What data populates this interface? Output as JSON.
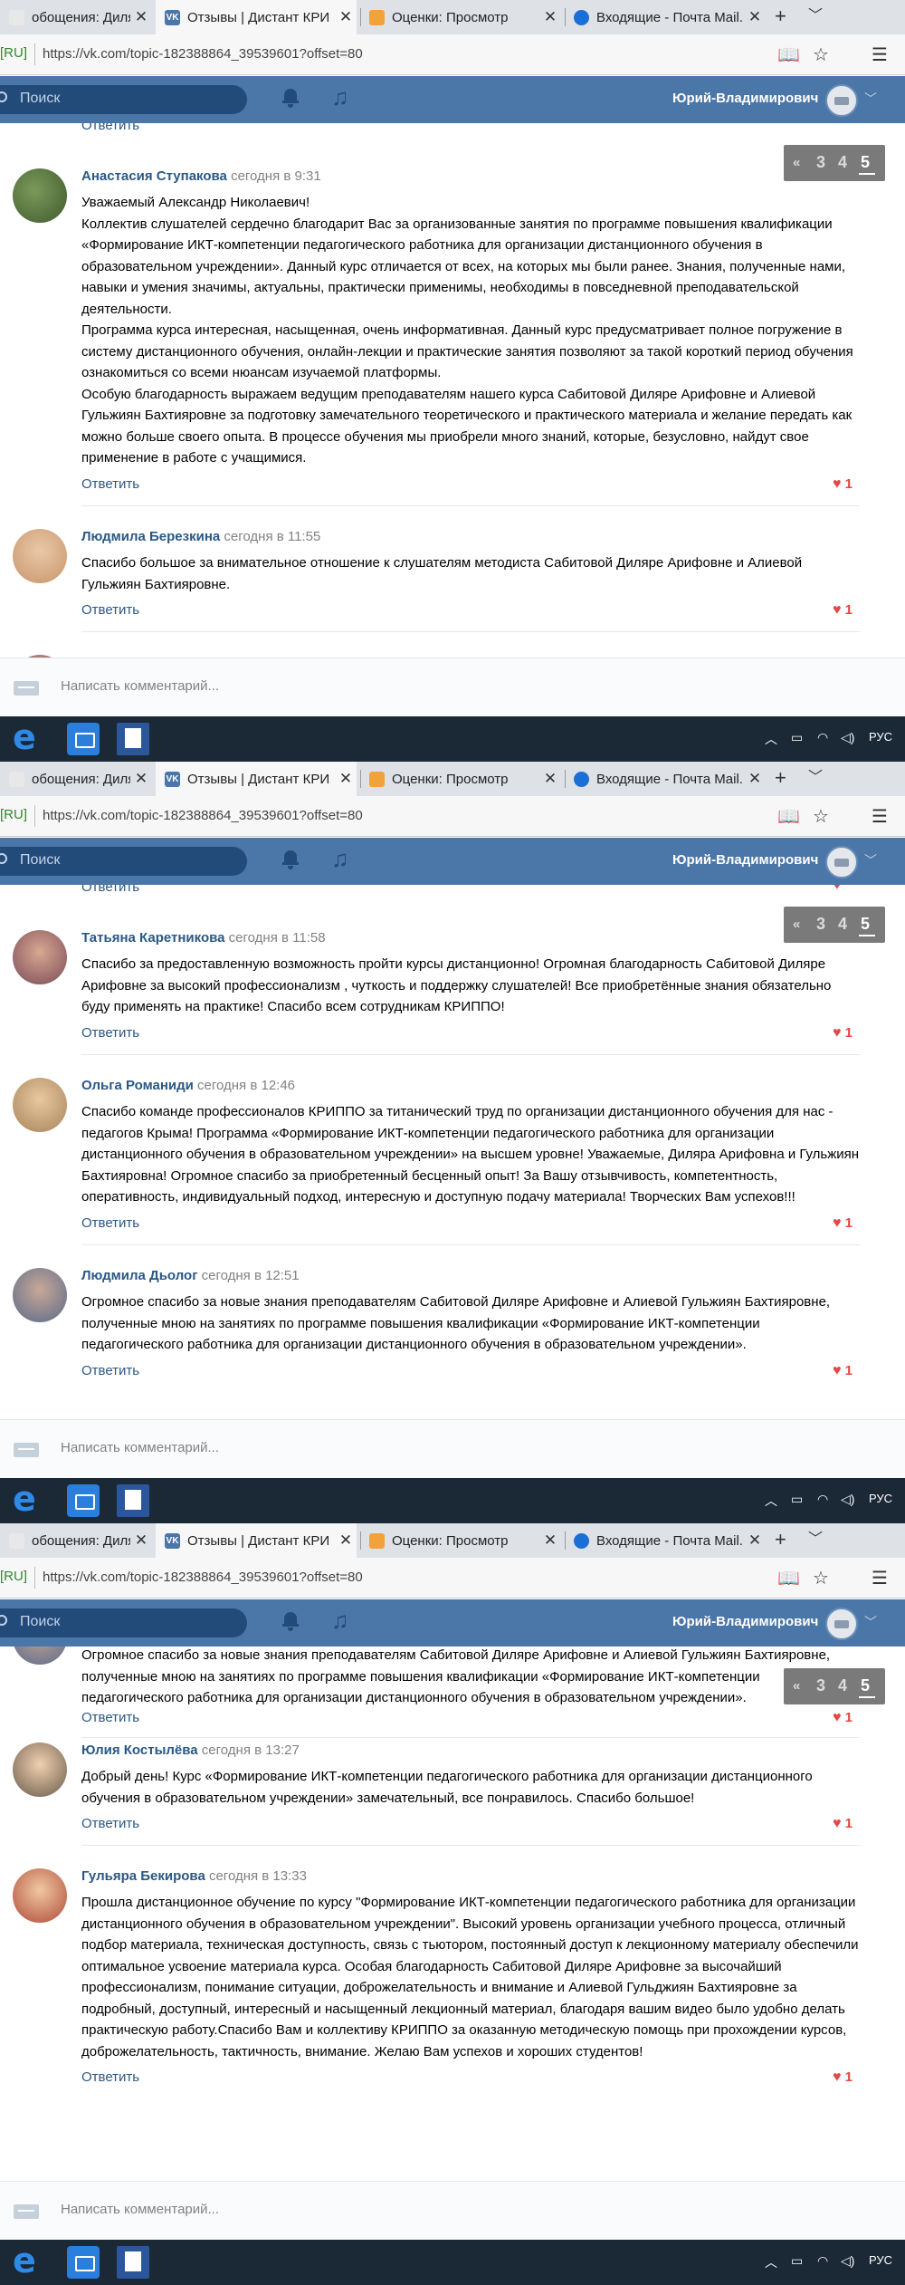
{
  "browser": {
    "tabs": [
      {
        "label": "обощения: Диляра Саби",
        "active": false
      },
      {
        "label": "Отзывы | Дистант КРИ",
        "active": true
      },
      {
        "label": "Оценки: Просмотр",
        "active": false
      },
      {
        "label": "Входящие - Почта Mail.ru",
        "active": false
      }
    ],
    "new_tab": "+",
    "lang_indicator": "[RU]",
    "url": "https://vk.com/topic-182388864_39539601?offset=80"
  },
  "vk": {
    "search_placeholder": "Поиск",
    "user_name": "Юрий-Владимирович",
    "pager": {
      "prev": "«",
      "pages": [
        "3",
        "4",
        "5"
      ],
      "current": "5"
    },
    "comment_placeholder": "Написать комментарий...",
    "reply_label": "Ответить"
  },
  "taskbar": {
    "lang": "РУС",
    "tray_icons": [
      "chevron-up-icon",
      "network-icon",
      "wifi-icon",
      "volume-icon"
    ]
  },
  "panels": [
    {
      "top_link": "Ответить",
      "comments": [
        {
          "name": "Анастасия Ступакова",
          "date": "сегодня в 9:31",
          "text": "Уважаемый Александр Николаевич!\nКоллектив слушателей сердечно благодарит Вас за организованные занятия по программе повышения квалификации «Формирование ИКТ-компетенции педагогического работника для организации дистанционного обучения в образовательном учреждении». Данный курс отличается от всех, на которых мы были ранее. Знания, полученные нами, навыки и умения значимы, актуальны, практически применимы, необходимы в повседневной преподавательской деятельности.\nПрограмма курса интересная, насыщенная, очень информативная. Данный курс предусматривает полное погружение в систему дистанционного обучения, онлайн-лекции и практические занятия позволяют за такой короткий период обучения ознакомиться со всеми нюансам изучаемой платформы.\nОсобую благодарность выражаем ведущим преподавателям нашего курса Сабитовой Диляре Арифовне и Алиевой Гульжиян Бахтияровне за подготовку замечательного теоретического и практического материала и желание передать как можно больше своего опыта. В процессе обучения мы приобрели много знаний, которые, безусловно, найдут свое применение в работе с учащимися.",
          "likes": "1"
        },
        {
          "name": "Людмила Березкина",
          "date": "сегодня в 11:55",
          "text": "Спасибо большое за внимательное отношение к слушателям методиста Сабитовой Диляре Арифовне и Алиевой Гульжиян Бахтияровне.",
          "likes": "1"
        },
        {
          "name": "Татьяна Каретникова",
          "date": "сегодня в 11:58",
          "text": "",
          "likes": ""
        }
      ]
    },
    {
      "top_link": "Ответить",
      "comments": [
        {
          "name": "Татьяна Каретникова",
          "date": "сегодня в 11:58",
          "text": "Спасибо за предоставленную возможность пройти курсы дистанционно! Огромная благодарность Сабитовой Диляре Арифовне за высокий профессионализм , чуткость и поддержку слушателей! Все приобретённые знания обязательно буду применять на практике! Спасибо всем сотрудникам КРИППО!",
          "likes": "1"
        },
        {
          "name": "Ольга Романиди",
          "date": "сегодня в 12:46",
          "text": "Спасибо команде профессионалов КРИППО за титанический труд по организации дистанционного обучения для нас - педагогов Крыма! Программа «Формирование ИКТ-компетенции педагогического работника для организации дистанционного обучения в образовательном учреждении» на высшем уровне! Уважаемые, Диляра Арифовна и Гульжиян Бахтияровна! Огромное спасибо за приобретенный бесценный опыт! За Вашу отзывчивость, компетентность, оперативность, индивидуальный подход, интересную и доступную подачу материала! Творческих Вам успехов!!!",
          "likes": "1"
        },
        {
          "name": "Людмила Дьолог",
          "date": "сегодня в 12:51",
          "text": "Огромное спасибо за новые знания преподавателям Сабитовой Диляре Арифовне и Алиевой Гульжиян Бахтияровне, полученные мною на занятиях по программе повышения квалификации «Формирование ИКТ-компетенции педагогического работника для организации дистанционного обучения в образовательном учреждении».",
          "likes": "1"
        }
      ]
    },
    {
      "top_link": "",
      "partial_text": "Огромное спасибо за новые знания преподавателям Сабитовой Диляре Арифовне и Алиевой Гульжиян Бахтияровне, полученные мною на занятиях по программе повышения квалификации «Формирование ИКТ-компетенции педагогического работника для организации дистанционного обучения в образовательном учреждении».",
      "partial_likes": "1",
      "comments": [
        {
          "name": "Юлия Костылёва",
          "date": "сегодня в 13:27",
          "text": "Добрый день! Курс «Формирование ИКТ-компетенции педагогического работника для организации дистанционного обучения в образовательном учреждении» замечательный, все понравилось. Спасибо большое!",
          "likes": "1"
        },
        {
          "name": "Гульяра Бекирова",
          "date": "сегодня в 13:33",
          "text": "Прошла дистанционное обучение по курсу \"Формирование ИКТ-компетенции педагогического работника для организации дистанционного обучения в образовательном учреждении\". Высокий уровень организации учебного процесса, отличный подбор материала, техническая доступность, связь с тьютором, постоянный доступ к лекционному материалу обеспечили оптимальное усвоение материала курса. Особая благодарность Сабитовой Диляре Арифовне за высочайший профессионализм, понимание ситуации, доброжелательность и внимание и Алиевой Гульджиян Бахтияровне за подробный, доступный, интересный и насыщенный лекционный материал, благодаря вашим видео было удобно делать практическую работу.Спасибо Вам и коллективу КРИППО за оказанную методическую помощь при прохождении курсов, доброжелательность, тактичность, внимание. Желаю Вам успехов и хороших студентов!",
          "likes": "1"
        }
      ]
    }
  ]
}
